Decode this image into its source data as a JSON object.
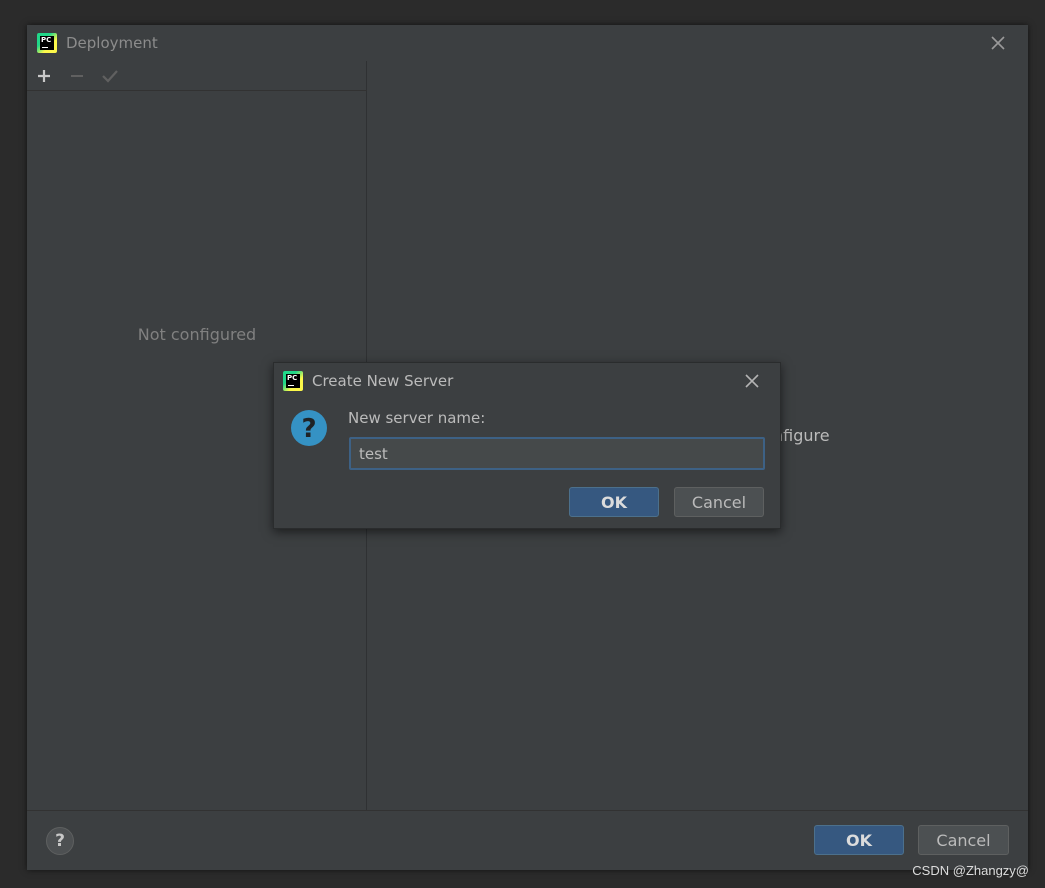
{
  "main_window": {
    "title": "Deployment",
    "toolbar": {
      "add_icon": "plus-icon",
      "remove_icon": "minus-icon",
      "check_icon": "check-icon"
    },
    "left_panel_empty_text": "Not configured",
    "right_panel_partial_text": "nfigure",
    "ok_label": "OK",
    "cancel_label": "Cancel",
    "help_label": "?"
  },
  "popup": {
    "title": "Create New Server",
    "field_label": "New server name:",
    "field_value": "test",
    "ok_label": "OK",
    "cancel_label": "Cancel",
    "icon": "question-icon"
  },
  "logo_text": "PC",
  "watermark": "CSDN @Zhangzy@",
  "colors": {
    "background": "#3c3f41",
    "default_button": "#365880",
    "input_focus_border": "#3d6185",
    "question_icon": "#3592c4"
  }
}
